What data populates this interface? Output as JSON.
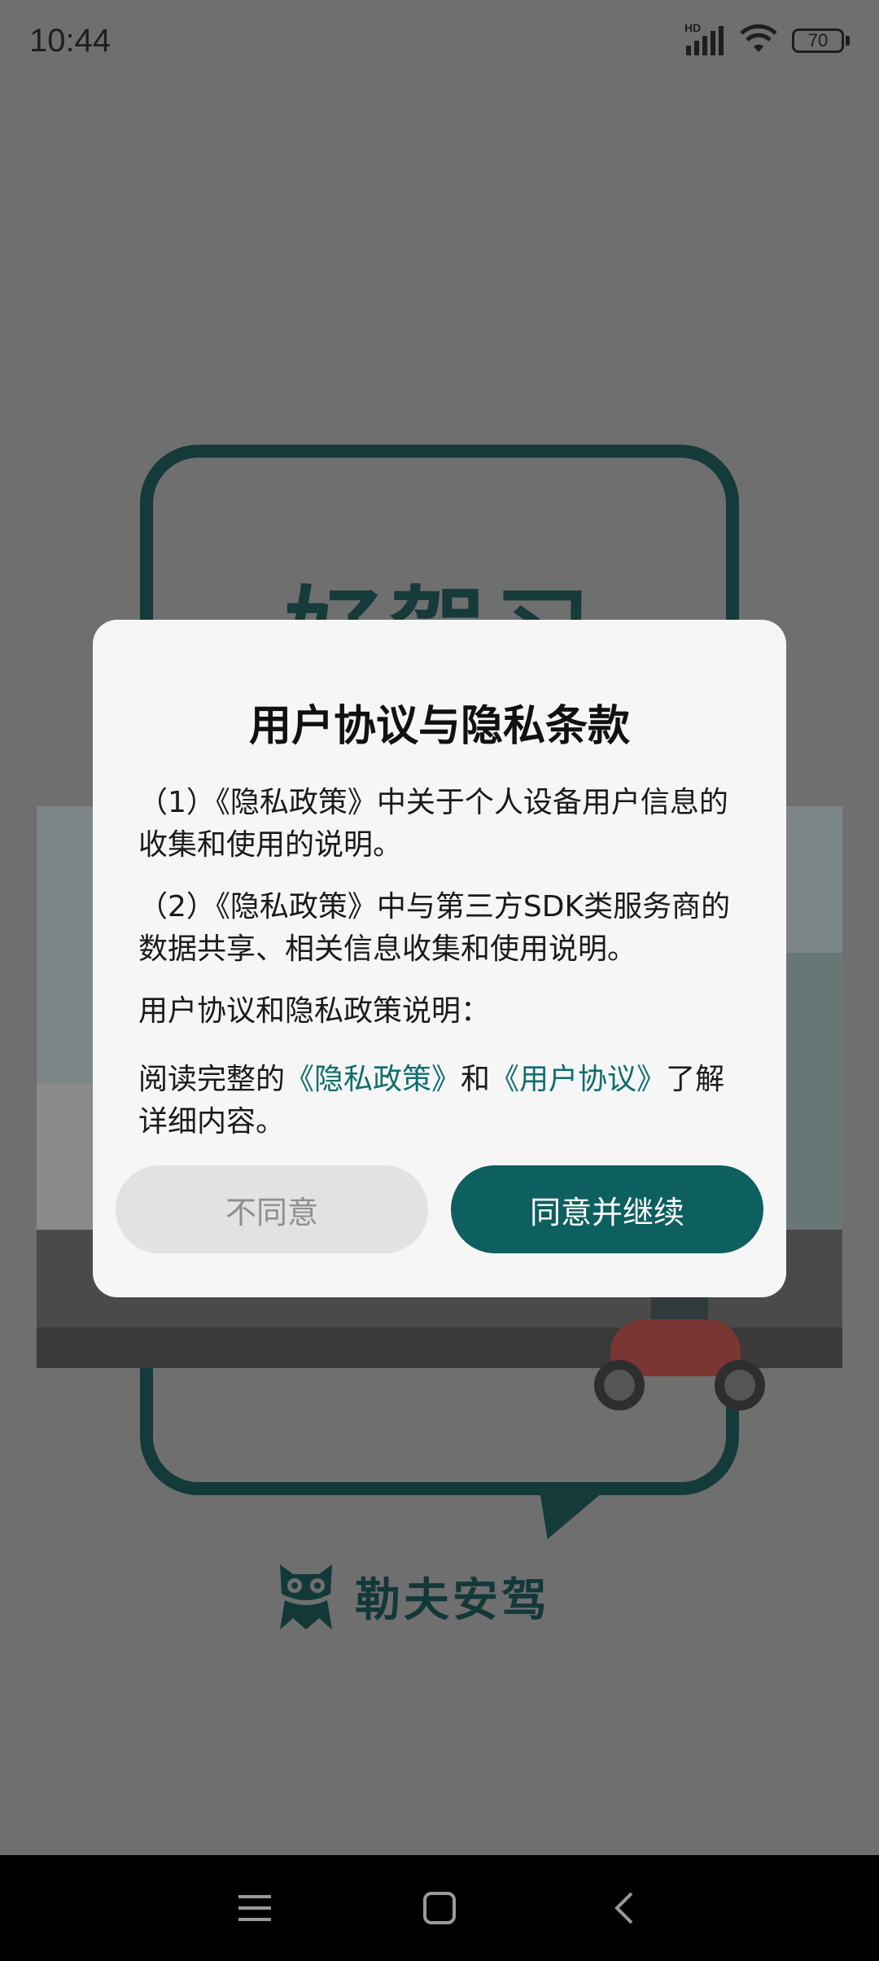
{
  "status_bar": {
    "time": "10:44",
    "network_label": "HD",
    "battery_level": "70",
    "icons": [
      "signal-icon",
      "wifi-icon",
      "battery-icon"
    ]
  },
  "background": {
    "splash_title": "好驾习",
    "brand_name": "勒夫安驾"
  },
  "dialog": {
    "title": "用户协议与隐私条款",
    "item1": "（1）《隐私政策》中关于个人设备用户信息的收集和使用的说明。",
    "item2": "（2）《隐私政策》中与第三方SDK类服务商的数据共享、相关信息收集和使用说明。",
    "item3": "用户协议和隐私政策说明：",
    "read_prefix": "阅读完整的",
    "privacy_link": "《隐私政策》",
    "and_text": "和",
    "agreement_link": "《用户协议》",
    "read_suffix": "了解详细内容。",
    "disagree_label": "不同意",
    "agree_label": "同意并继续"
  },
  "colors": {
    "accent": "#0e5f5f",
    "link": "#0f6e6c",
    "scrim": "#6f6f6f"
  },
  "nav_bar": {
    "icons": [
      "menu-icon",
      "home-icon",
      "back-icon"
    ]
  }
}
